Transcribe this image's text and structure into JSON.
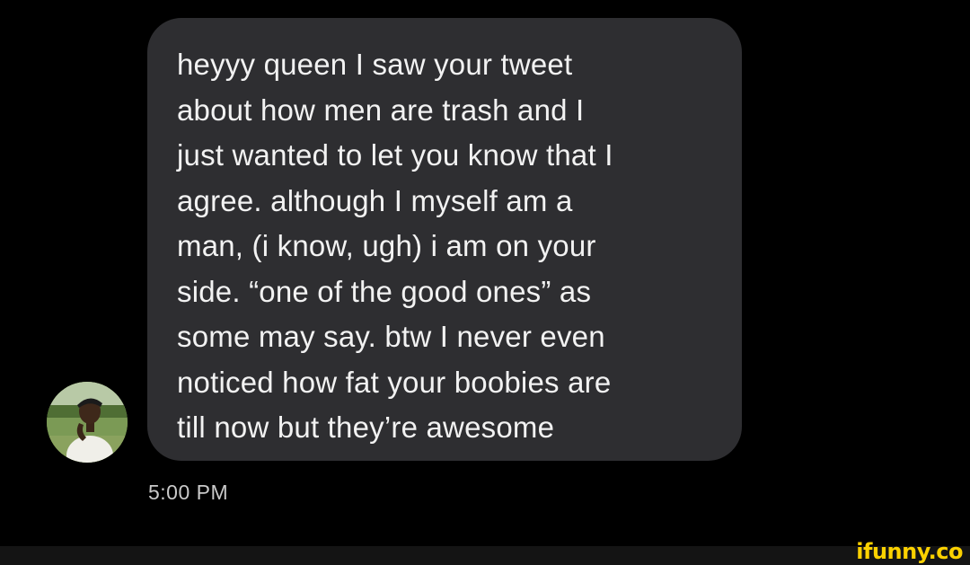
{
  "conversation": {
    "message": {
      "text": "heyyy queen I saw your tweet\nabout how men are trash and I\njust wanted to let you know that I\nagree. although I myself am a\nman, (i know, ugh) i am on your\nside. “one of the good ones” as\nsome may say. btw I never even\nnoticed how fat your boobies are\ntill now but they’re awesome",
      "timestamp": "5:00 PM",
      "sender_avatar_icon": "user-avatar-photo"
    }
  },
  "watermark": {
    "text": "ifunny.co",
    "color": "#fbd100"
  },
  "colors": {
    "background": "#000000",
    "bubble": "#2e2e31",
    "text": "#f2f2f2",
    "timestamp": "#c9c9c9"
  }
}
